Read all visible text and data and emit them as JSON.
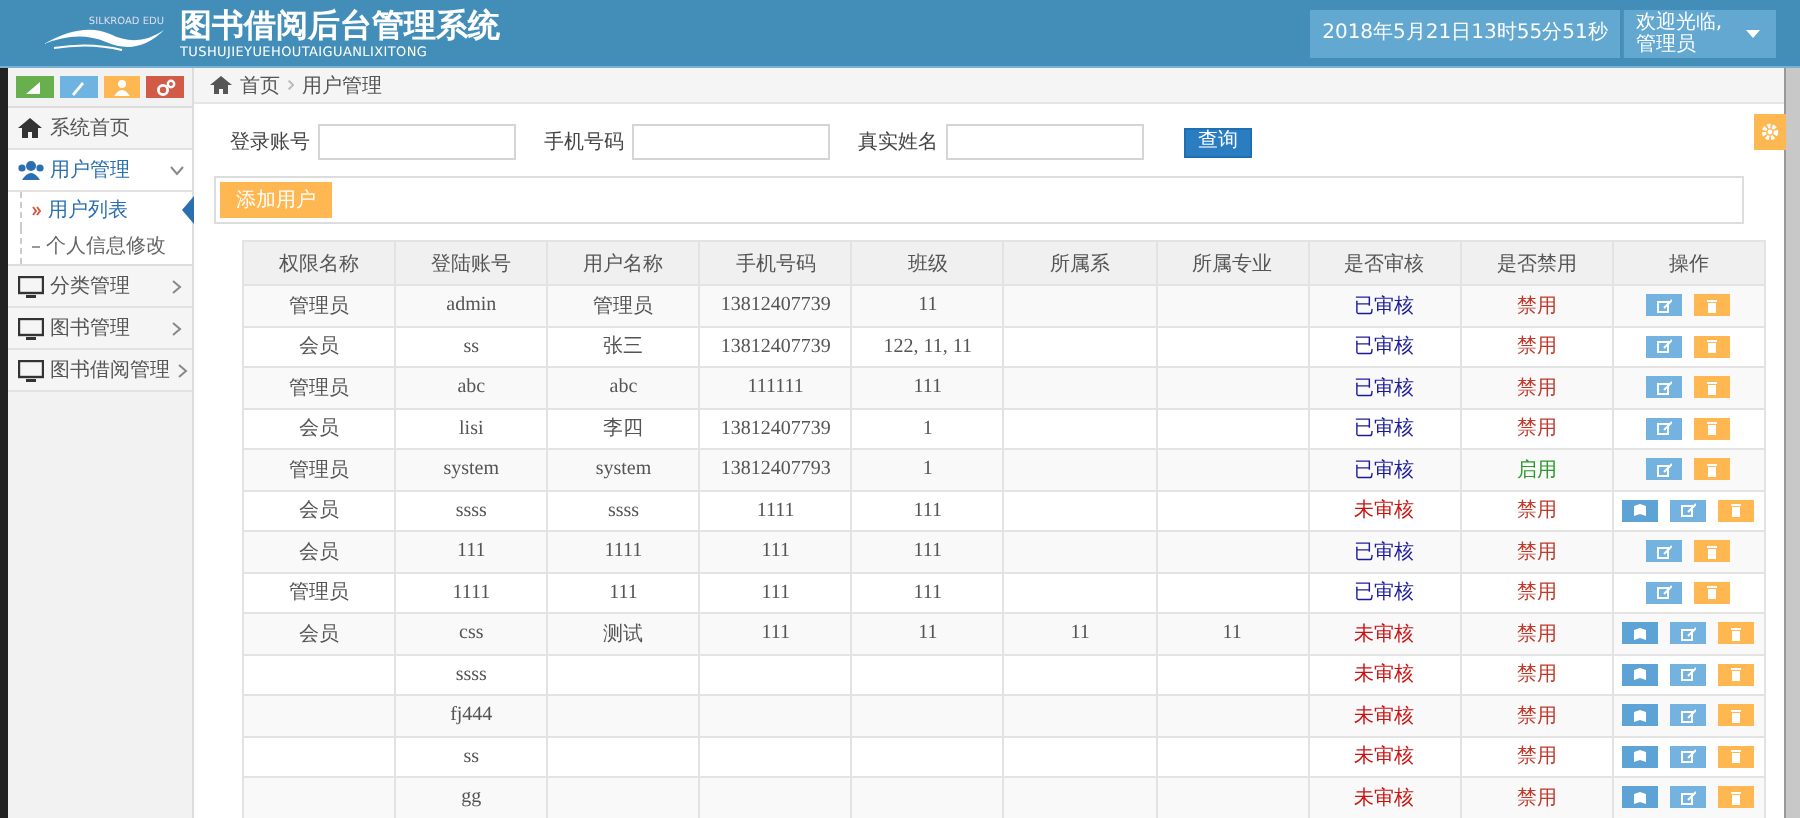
{
  "header": {
    "logo_text": "SILKROAD EDU",
    "title": "图书借阅后台管理系统",
    "subtitle": "TUSHUJIEYUEHOUTAIGUANLIXITONG",
    "datetime": "2018年5月21日13时55分51秒",
    "welcome": "欢迎光临,",
    "user": "管理员"
  },
  "sidebar": {
    "shortcuts": [
      {
        "kind": "chart",
        "color": "#68b04e"
      },
      {
        "kind": "pencil",
        "color": "#6fb3e0"
      },
      {
        "kind": "users",
        "color": "#ffb752"
      },
      {
        "kind": "cogs",
        "color": "#d15b47"
      }
    ],
    "menu": [
      {
        "label": "系统首页",
        "kind": "home"
      },
      {
        "label": "用户管理",
        "kind": "users",
        "expanded": true,
        "children": [
          {
            "label": "用户列表",
            "selected": true
          },
          {
            "label": "个人信息修改",
            "selected": false
          }
        ]
      },
      {
        "label": "分类管理",
        "kind": "monitor",
        "expanded": false
      },
      {
        "label": "图书管理",
        "kind": "monitor",
        "expanded": false
      },
      {
        "label": "图书借阅管理",
        "kind": "monitor",
        "expanded": false
      }
    ]
  },
  "breadcrumb": [
    "首页",
    "用户管理"
  ],
  "search": {
    "fields": [
      {
        "label": "登录账号"
      },
      {
        "label": "手机号码"
      },
      {
        "label": "真实姓名"
      }
    ],
    "button": "查询"
  },
  "add_button": "添加用户",
  "table": {
    "columns": [
      "权限名称",
      "登陆账号",
      "用户名称",
      "手机号码",
      "班级",
      "所属系",
      "所属专业",
      "是否审核",
      "是否禁用",
      "操作"
    ],
    "rows": [
      {
        "role": "管理员",
        "account": "admin",
        "name": "管理员",
        "phone": "13812407739",
        "class": "11",
        "dept": "",
        "major": "",
        "audit": {
          "text": "已审核",
          "approved": true
        },
        "status": {
          "text": "禁用",
          "enabled": false
        }
      },
      {
        "role": "会员",
        "account": "ss",
        "name": "张三",
        "phone": "13812407739",
        "class": "122, 11, 11",
        "dept": "",
        "major": "",
        "audit": {
          "text": "已审核",
          "approved": true
        },
        "status": {
          "text": "禁用",
          "enabled": false
        }
      },
      {
        "role": "管理员",
        "account": "abc",
        "name": "abc",
        "phone": "111111",
        "class": "111",
        "dept": "",
        "major": "",
        "audit": {
          "text": "已审核",
          "approved": true
        },
        "status": {
          "text": "禁用",
          "enabled": false
        }
      },
      {
        "role": "会员",
        "account": "lisi",
        "name": "李四",
        "phone": "13812407739",
        "class": "1",
        "dept": "",
        "major": "",
        "audit": {
          "text": "已审核",
          "approved": true
        },
        "status": {
          "text": "禁用",
          "enabled": false
        }
      },
      {
        "role": "管理员",
        "account": "system",
        "name": "system",
        "phone": "13812407793",
        "class": "1",
        "dept": "",
        "major": "",
        "audit": {
          "text": "已审核",
          "approved": true
        },
        "status": {
          "text": "启用",
          "enabled": true
        }
      },
      {
        "role": "会员",
        "account": "ssss",
        "name": "ssss",
        "phone": "1111",
        "class": "111",
        "dept": "",
        "major": "",
        "audit": {
          "text": "未审核",
          "approved": false
        },
        "status": {
          "text": "禁用",
          "enabled": false
        }
      },
      {
        "role": "会员",
        "account": "111",
        "name": "1111",
        "phone": "111",
        "class": "111",
        "dept": "",
        "major": "",
        "audit": {
          "text": "已审核",
          "approved": true
        },
        "status": {
          "text": "禁用",
          "enabled": false
        }
      },
      {
        "role": "管理员",
        "account": "1111",
        "name": "111",
        "phone": "111",
        "class": "111",
        "dept": "",
        "major": "",
        "audit": {
          "text": "已审核",
          "approved": true
        },
        "status": {
          "text": "禁用",
          "enabled": false
        }
      },
      {
        "role": "会员",
        "account": "css",
        "name": "测试",
        "phone": "111",
        "class": "11",
        "dept": "11",
        "major": "11",
        "audit": {
          "text": "未审核",
          "approved": false
        },
        "status": {
          "text": "禁用",
          "enabled": false
        }
      },
      {
        "role": "",
        "account": "ssss",
        "name": "",
        "phone": "",
        "class": "",
        "dept": "",
        "major": "",
        "audit": {
          "text": "未审核",
          "approved": false
        },
        "status": {
          "text": "禁用",
          "enabled": false
        }
      },
      {
        "role": "",
        "account": "fj444",
        "name": "",
        "phone": "",
        "class": "",
        "dept": "",
        "major": "",
        "audit": {
          "text": "未审核",
          "approved": false
        },
        "status": {
          "text": "禁用",
          "enabled": false
        }
      },
      {
        "role": "",
        "account": "ss",
        "name": "",
        "phone": "",
        "class": "",
        "dept": "",
        "major": "",
        "audit": {
          "text": "未审核",
          "approved": false
        },
        "status": {
          "text": "禁用",
          "enabled": false
        }
      },
      {
        "role": "",
        "account": "gg",
        "name": "",
        "phone": "",
        "class": "",
        "dept": "",
        "major": "",
        "audit": {
          "text": "未审核",
          "approved": false
        },
        "status": {
          "text": "禁用",
          "enabled": false
        }
      }
    ]
  }
}
